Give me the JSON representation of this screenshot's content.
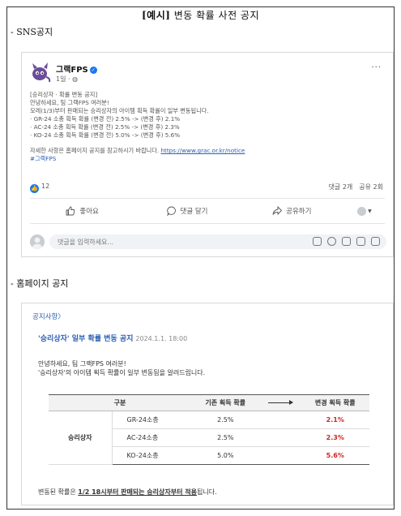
{
  "doc": {
    "title_bracket": "[예시]",
    "title_rest": " 변동 확률 사전 공지",
    "section_sns": "- SNS공지",
    "section_homepage": "- 홈페이지 공지"
  },
  "sns": {
    "page_name": "그랙FPS",
    "post_meta": "1일 · ",
    "more_label": "···",
    "body": {
      "l1": "[승리상자 · 확률 변동 공지]",
      "l2": "안녕하세요, 팀 그랙FPS 여러분!",
      "l3": "모레(1/3)부터 판매되는 승리상자의 아이템 획득 확률이 일부 변동됩니다.",
      "l4": "· GR-24 소총 획득 확률 (변경 전) 2.5% -> (변경 후) 2.1%",
      "l5": "· AC-24 소총 획득 확률 (변경 전) 2.5% -> (변경 후) 2.3%",
      "l6": "· KO-24 소총 획득 확률 (변경 전) 5.0% -> (변경 후) 5.6%",
      "l7": "자세한 사항은 홈페이지 공지를 참고하시기 바랍니다. ",
      "link": "https://www.grac.or.kr/notice",
      "hashtag": "#그랙FPS"
    },
    "like_count": "12",
    "comments_count": "댓글 2개",
    "shares_count": "공유 2회",
    "actions": {
      "like": "좋아요",
      "comment": "댓글 달기",
      "share": "공유하기"
    },
    "comment_placeholder": "댓글을 입력하세요..."
  },
  "homepage": {
    "breadcrumb": "공지사항〉",
    "title": "'승리상자' 일부 확률 변동 공지",
    "date": "2024.1.1. 18:00",
    "text1": "안녕하세요, 팀 그랙FPS 여러분!",
    "text2": "'승리상자'의 아이템 획득 확률이 일부 변동됨을 알려드립니다.",
    "table": {
      "headers": {
        "category": "구분",
        "before": "기존 획득 확률",
        "after": "변경 획득 확률"
      },
      "category": "승리상자",
      "rows": [
        {
          "item": "GR-24소총",
          "before": "2.5%",
          "after": "2.1%"
        },
        {
          "item": "AC-24소총",
          "before": "2.5%",
          "after": "2.3%"
        },
        {
          "item": "KO-24소총",
          "before": "5.0%",
          "after": "5.6%"
        }
      ]
    },
    "footer_pre": "변동된 확률은 ",
    "footer_underline": "1/2 18시부터 판매되는 승리상자부터 적용",
    "footer_post": "됩니다."
  },
  "colors": {
    "facebook_blue": "#1877f2",
    "link_blue": "#2b5fb4",
    "changed_red": "#d62020"
  },
  "icons": [
    "logo-character-icon",
    "verified-icon",
    "more-icon",
    "like-thumb-icon",
    "comment-bubble-icon",
    "share-arrow-icon",
    "caret-down-icon",
    "photo-icon",
    "emoji-icon",
    "camera-icon",
    "gif-icon",
    "sticker-icon"
  ]
}
